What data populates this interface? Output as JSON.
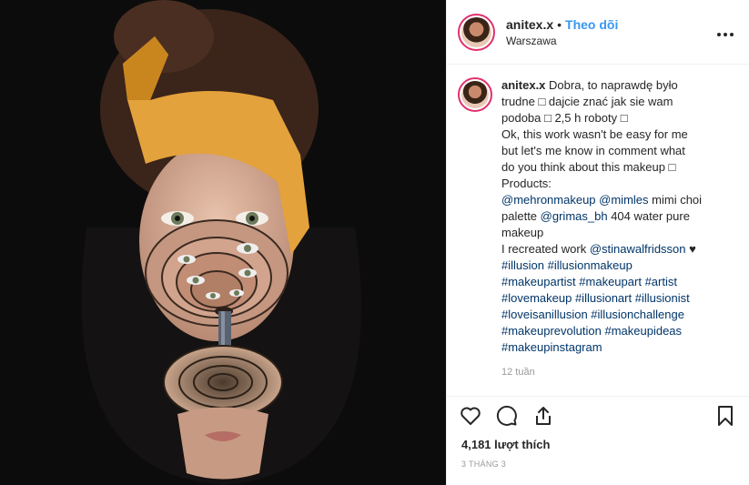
{
  "header": {
    "username": "anitex.x",
    "separator": "•",
    "follow_label": "Theo dõi",
    "location": "Warszawa",
    "more_icon": "more-horizontal-icon"
  },
  "caption": {
    "username": "anitex.x",
    "line1": "Dobra, to naprawdę było",
    "line2": "trudne □ dajcie znać jak sie wam",
    "line3": "podoba □ 2,5 h roboty □",
    "line4": "Ok, this work wasn't be easy for me",
    "line5": "but let's me know in comment what",
    "line6": "do you think about this makeup □",
    "line7": "Products:",
    "mention1": "@mehronmakeup",
    "mention2": "@mimles",
    "products_text1": "mimi choi",
    "products_text2": "palette",
    "mention3": "@grimas_bh",
    "products_text3": "404 water pure",
    "products_text4": "makeup",
    "recreated_text": "I recreated work",
    "mention4": "@stinawalfridsson",
    "heart": "♥",
    "tags": [
      [
        "#illusion",
        "#illusionmakeup"
      ],
      [
        "#makeupartist",
        "#makeupart",
        "#artist"
      ],
      [
        "#lovemakeup",
        "#illusionart",
        "#illusionist"
      ],
      [
        "#loveisanillusion",
        "#illusionchallenge"
      ],
      [
        "#makeuprevolution",
        "#makeupideas"
      ],
      [
        "#makeupinstagram"
      ]
    ],
    "time_ago": "12 tuần"
  },
  "actions": {
    "like_icon": "heart-outline-icon",
    "comment_icon": "comment-bubble-icon",
    "share_icon": "share-icon",
    "save_icon": "bookmark-icon"
  },
  "likes_text": "4,181 lượt thích",
  "post_date": "3 THÁNG 3",
  "colors": {
    "link": "#003569",
    "follow": "#3897f0",
    "text": "#262626",
    "muted": "#999999",
    "headband": "#e3a23b"
  }
}
